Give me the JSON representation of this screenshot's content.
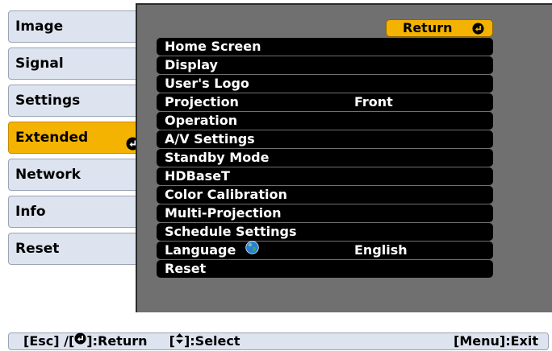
{
  "sidebar": {
    "tabs": [
      {
        "label": "Image"
      },
      {
        "label": "Signal"
      },
      {
        "label": "Settings"
      },
      {
        "label": "Extended",
        "active": true
      },
      {
        "label": "Network"
      },
      {
        "label": "Info"
      },
      {
        "label": "Reset"
      }
    ]
  },
  "panel": {
    "return_label": "Return",
    "items": [
      {
        "label": "Home Screen",
        "value": ""
      },
      {
        "label": "Display",
        "value": ""
      },
      {
        "label": "User's Logo",
        "value": ""
      },
      {
        "label": "Projection",
        "value": "Front"
      },
      {
        "label": "Operation",
        "value": ""
      },
      {
        "label": "A/V Settings",
        "value": ""
      },
      {
        "label": "Standby Mode",
        "value": ""
      },
      {
        "label": "HDBaseT",
        "value": ""
      },
      {
        "label": "Color Calibration",
        "value": ""
      },
      {
        "label": "Multi-Projection",
        "value": ""
      },
      {
        "label": "Schedule Settings",
        "value": ""
      },
      {
        "label": "Language",
        "value": "English",
        "icon": "globe-icon"
      },
      {
        "label": "Reset",
        "value": ""
      }
    ]
  },
  "helpbar": {
    "esc_text": "[Esc] /[",
    "return_text": "]:Return",
    "select_prefix": "[",
    "select_text": "]:Select",
    "exit_text": "[Menu]:Exit"
  },
  "colors": {
    "accent": "#f5b301",
    "tab_bg": "#dde4f0",
    "panel_bg": "#707070",
    "row_bg": "#000000"
  }
}
